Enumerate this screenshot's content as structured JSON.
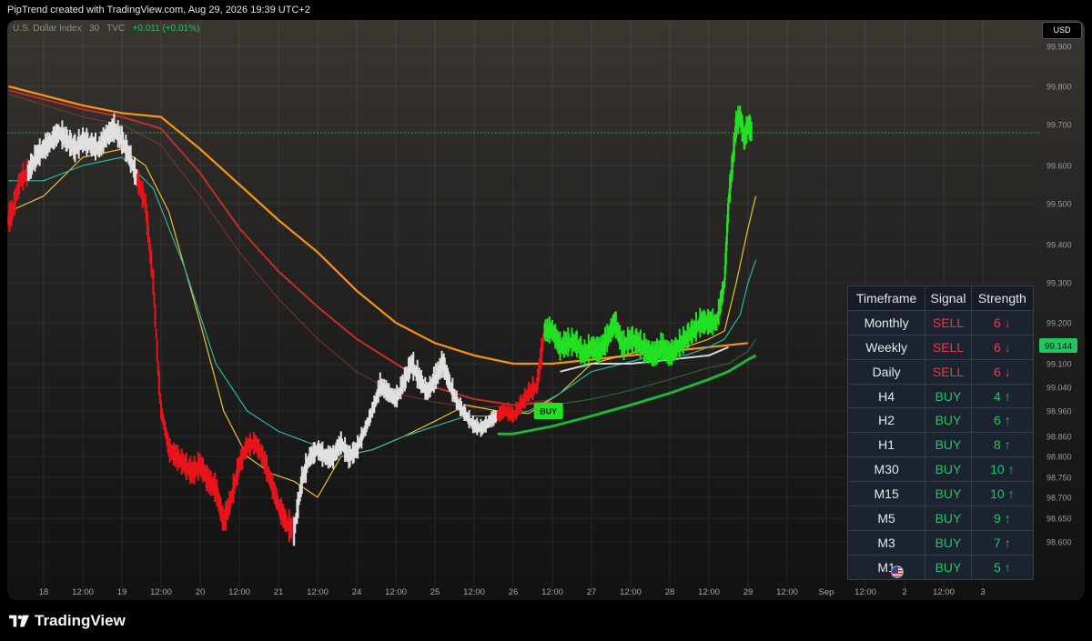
{
  "header": {
    "text": "PipTrend created with TradingView.com, Aug 29, 2026 19:39 UTC+2"
  },
  "legend": {
    "symbol": "U.S. Dollar Index",
    "interval": "30",
    "source": "TVC",
    "change": "+0.011 (+0.01%)"
  },
  "currency": "USD",
  "branding": "TradingView",
  "colors": {
    "bull": "#22e022",
    "bear": "#e8151b",
    "neutral": "#e0e0e0",
    "sell": "#f23645",
    "buy": "#22c55e",
    "ema_orange": "#f7931a",
    "ema_red": "#c0302a",
    "ema_yellow": "#e8c330",
    "ema_teal": "#2bb5a6",
    "ema_green": "#22b33a",
    "ema_white": "#d6d6d6"
  },
  "chart_data": {
    "type": "line",
    "title": "",
    "xlabel": "",
    "ylabel": "",
    "y_tick_labels": [
      "99.900",
      "99.800",
      "99.700",
      "99.600",
      "99.500",
      "99.400",
      "99.300",
      "99.200",
      "99.144",
      "99.100",
      "99.040",
      "98.960",
      "98.860",
      "98.800",
      "98.750",
      "98.700",
      "98.650",
      "98.600"
    ],
    "y_tick_values": [
      99.9,
      99.8,
      99.7,
      99.6,
      99.5,
      99.4,
      99.3,
      99.2,
      99.144,
      99.1,
      99.04,
      98.96,
      98.86,
      98.8,
      98.75,
      98.7,
      98.65,
      98.6
    ],
    "last_price_label": "99.144",
    "x_tick_labels": [
      "18",
      "12:00",
      "19",
      "12:00",
      "20",
      "12:00",
      "21",
      "12:00",
      "24",
      "12:00",
      "25",
      "12:00",
      "26",
      "12:00",
      "27",
      "12:00",
      "28",
      "12:00",
      "29",
      "12:00",
      "Sep",
      "12:00",
      "2",
      "12:00",
      "3"
    ],
    "x_tick_pos": [
      0,
      0.5,
      1,
      1.5,
      2,
      2.5,
      3,
      3.5,
      4,
      4.5,
      5,
      5.5,
      6,
      6.5,
      7,
      7.5,
      8,
      8.5,
      9,
      9.5,
      10,
      10.5,
      11,
      11.5,
      12
    ],
    "x_unit": "trading-day index (0 = Aug 18)",
    "price": {
      "x": [
        -0.45,
        -0.4,
        -0.3,
        -0.2,
        -0.1,
        0,
        0.1,
        0.2,
        0.3,
        0.4,
        0.5,
        0.6,
        0.7,
        0.8,
        0.9,
        1.0,
        1.1,
        1.2,
        1.3,
        1.4,
        1.5,
        1.6,
        1.7,
        1.8,
        1.9,
        2.0,
        2.1,
        2.2,
        2.3,
        2.4,
        2.5,
        2.6,
        2.7,
        2.8,
        2.9,
        3.0,
        3.1,
        3.2,
        3.3,
        3.4,
        3.5,
        3.6,
        3.7,
        3.8,
        3.9,
        4.0,
        4.1,
        4.2,
        4.3,
        4.4,
        4.5,
        4.6,
        4.7,
        4.8,
        4.9,
        5.0,
        5.1,
        5.2,
        5.3,
        5.4,
        5.5,
        5.6,
        5.7,
        5.8,
        5.9,
        6.0,
        6.1,
        6.2,
        6.3,
        6.4,
        6.5,
        6.6,
        6.7,
        6.8,
        6.9,
        7.0,
        7.1,
        7.2,
        7.3,
        7.4,
        7.5,
        7.6,
        7.7,
        7.8,
        7.9,
        8.0,
        8.1,
        8.2,
        8.3,
        8.4,
        8.5,
        8.6,
        8.7,
        8.75,
        8.8,
        8.85,
        8.9,
        8.95,
        9.0,
        9.05
      ],
      "y": [
        99.46,
        99.48,
        99.56,
        99.58,
        99.62,
        99.64,
        99.66,
        99.68,
        99.66,
        99.64,
        99.66,
        99.65,
        99.64,
        99.67,
        99.69,
        99.66,
        99.62,
        99.56,
        99.5,
        99.3,
        98.96,
        98.82,
        98.8,
        98.78,
        98.76,
        98.78,
        98.74,
        98.72,
        98.64,
        98.7,
        98.78,
        98.83,
        98.84,
        98.8,
        98.74,
        98.68,
        98.64,
        98.62,
        98.74,
        98.8,
        98.82,
        98.8,
        98.8,
        98.84,
        98.8,
        98.82,
        98.88,
        98.96,
        99.04,
        99.02,
        99.0,
        99.05,
        99.1,
        99.06,
        99.02,
        99.06,
        99.1,
        99.04,
        98.98,
        98.94,
        98.9,
        98.89,
        98.92,
        98.94,
        98.96,
        98.94,
        98.98,
        99.02,
        99.04,
        99.18,
        99.18,
        99.14,
        99.15,
        99.15,
        99.12,
        99.14,
        99.13,
        99.16,
        99.2,
        99.14,
        99.16,
        99.15,
        99.13,
        99.12,
        99.14,
        99.12,
        99.14,
        99.16,
        99.18,
        99.2,
        99.2,
        99.2,
        99.3,
        99.5,
        99.6,
        99.7,
        99.72,
        99.66,
        99.7,
        99.68
      ]
    },
    "series": [
      {
        "name": "",
        "color": "ema_orange",
        "x": [
          -0.45,
          0.5,
          1.0,
          1.5,
          2.0,
          2.5,
          3.0,
          3.5,
          4.0,
          4.5,
          5.0,
          5.5,
          6.0,
          6.5,
          7.0,
          7.5,
          8.0,
          8.5,
          9.0
        ],
        "y": [
          99.8,
          99.75,
          99.73,
          99.72,
          99.64,
          99.55,
          99.46,
          99.38,
          99.28,
          99.2,
          99.15,
          99.12,
          99.1,
          99.1,
          99.11,
          99.12,
          99.13,
          99.14,
          99.15
        ]
      },
      {
        "name": "",
        "color": "ema_red",
        "x": [
          -0.45,
          0.5,
          1.0,
          1.5,
          2.0,
          2.5,
          3.0,
          3.5,
          4.0,
          4.5,
          5.0,
          5.5,
          6.0,
          6.5
        ],
        "y": [
          99.79,
          99.74,
          99.72,
          99.69,
          99.58,
          99.44,
          99.33,
          99.24,
          99.16,
          99.1,
          99.04,
          99.0,
          98.98,
          98.99
        ]
      },
      {
        "name": "",
        "color": "ema_red_faint",
        "x": [
          -0.45,
          0.5,
          1.0,
          1.5,
          2.0,
          2.5,
          3.0,
          3.5,
          4.0,
          4.5,
          5.0,
          5.5,
          6.0,
          6.5
        ],
        "y": [
          99.78,
          99.72,
          99.7,
          99.65,
          99.52,
          99.38,
          99.26,
          99.16,
          99.08,
          99.02,
          98.99,
          98.97,
          98.98,
          99.0
        ]
      },
      {
        "name": "",
        "color": "ema_yellow",
        "x": [
          -0.45,
          0.0,
          0.5,
          1.0,
          1.3,
          1.6,
          2.0,
          2.3,
          2.6,
          2.9,
          3.2,
          3.5,
          3.8,
          4.2,
          4.6,
          5.0,
          5.4,
          5.8,
          6.2,
          6.6,
          7.0,
          7.4,
          7.8,
          8.2,
          8.5,
          8.7,
          8.85,
          9.0,
          9.1
        ],
        "y": [
          99.48,
          99.52,
          99.62,
          99.64,
          99.6,
          99.48,
          99.2,
          98.96,
          98.8,
          98.76,
          98.74,
          98.7,
          98.8,
          98.82,
          98.86,
          98.92,
          98.98,
          98.96,
          98.95,
          99.02,
          99.1,
          99.12,
          99.14,
          99.14,
          99.16,
          99.18,
          99.3,
          99.44,
          99.52
        ]
      },
      {
        "name": "",
        "color": "ema_teal",
        "x": [
          -0.45,
          0.0,
          0.5,
          1.0,
          1.4,
          1.8,
          2.2,
          2.6,
          3.0,
          3.4,
          3.8,
          4.2,
          4.6,
          5.0,
          5.4,
          5.8,
          6.2,
          6.6,
          7.0,
          7.4,
          7.8,
          8.2,
          8.5,
          8.7,
          8.9,
          9.0,
          9.1
        ],
        "y": [
          99.56,
          99.56,
          99.6,
          99.62,
          99.54,
          99.34,
          99.1,
          98.96,
          98.88,
          98.84,
          98.8,
          98.82,
          98.86,
          98.9,
          98.94,
          98.94,
          98.96,
          99.02,
          99.08,
          99.1,
          99.12,
          99.12,
          99.14,
          99.16,
          99.22,
          99.3,
          99.36
        ]
      },
      {
        "name": "",
        "color": "ema_white",
        "x": [
          6.6,
          7.0,
          7.5,
          8.0,
          8.5,
          8.75
        ],
        "y": [
          99.08,
          99.1,
          99.1,
          99.11,
          99.12,
          99.14
        ]
      },
      {
        "name": "",
        "color": "ema_green",
        "x": [
          5.8,
          6.0,
          6.5,
          7.0,
          7.5,
          8.0,
          8.5,
          8.75,
          9.0,
          9.1
        ],
        "y": [
          98.87,
          98.87,
          98.9,
          98.94,
          98.98,
          99.02,
          99.06,
          99.08,
          99.11,
          99.12
        ]
      },
      {
        "name": "",
        "color": "ema_green_faint",
        "x": [
          6.5,
          7.0,
          7.5,
          8.0,
          8.5,
          8.75,
          9.0,
          9.1
        ],
        "y": [
          98.98,
          99.0,
          99.03,
          99.06,
          99.09,
          99.1,
          99.13,
          99.16
        ]
      }
    ],
    "signal_label": {
      "text": "BUY",
      "x": 6.45,
      "y": 98.96
    },
    "reference_line": {
      "y": 99.68
    },
    "grid": true
  },
  "table": {
    "headers": [
      "Timeframe",
      "Signal",
      "Strength"
    ],
    "rows": [
      {
        "tf": "Monthly",
        "signal": "SELL",
        "strength": "6 ↓"
      },
      {
        "tf": "Weekly",
        "signal": "SELL",
        "strength": "6 ↓"
      },
      {
        "tf": "Daily",
        "signal": "SELL",
        "strength": "6 ↓"
      },
      {
        "tf": "H4",
        "signal": "BUY",
        "strength": "4 ↑"
      },
      {
        "tf": "H2",
        "signal": "BUY",
        "strength": "6 ↑"
      },
      {
        "tf": "H1",
        "signal": "BUY",
        "strength": "8 ↑"
      },
      {
        "tf": "M30",
        "signal": "BUY",
        "strength": "10 ↑"
      },
      {
        "tf": "M15",
        "signal": "BUY",
        "strength": "10 ↑"
      },
      {
        "tf": "M5",
        "signal": "BUY",
        "strength": "9 ↑"
      },
      {
        "tf": "M3",
        "signal": "BUY",
        "strength": "7 ↑"
      },
      {
        "tf": "M1",
        "signal": "BUY",
        "strength": "5 ↑"
      }
    ]
  }
}
